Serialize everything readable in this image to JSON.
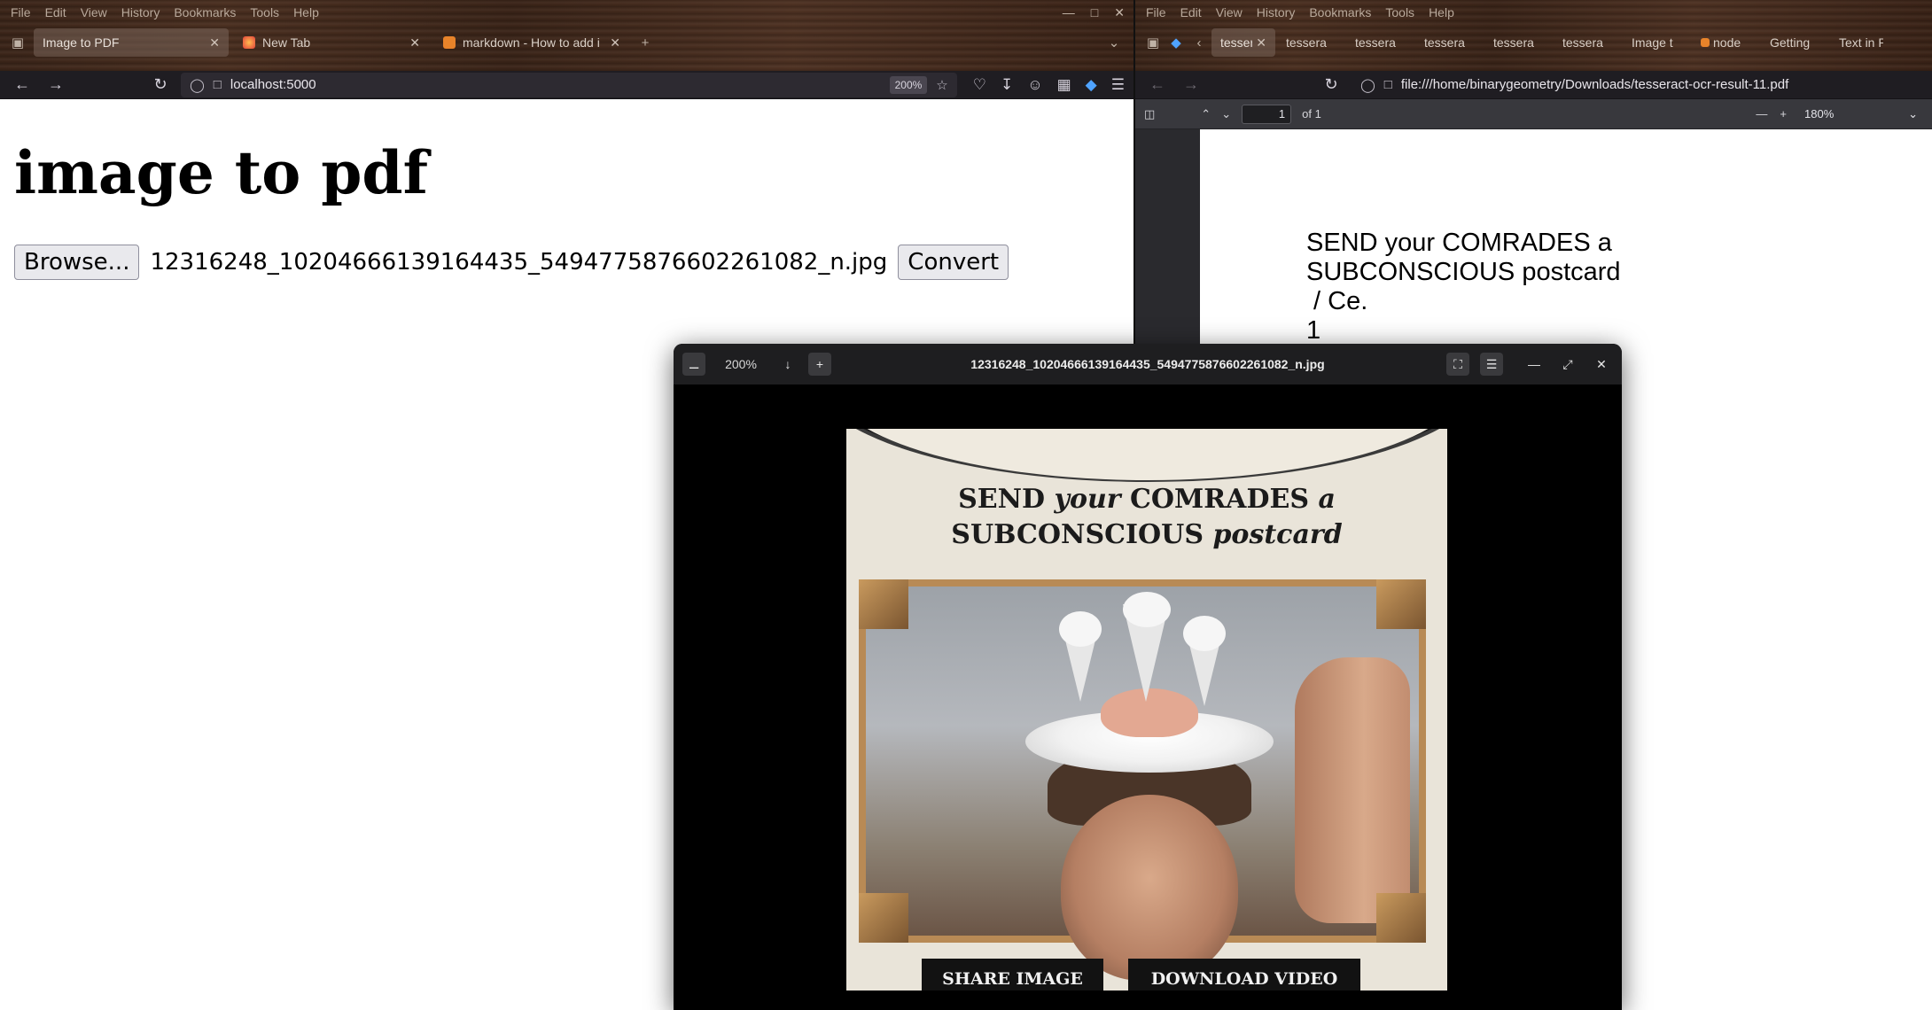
{
  "left_browser": {
    "menu": [
      "File",
      "Edit",
      "View",
      "History",
      "Bookmarks",
      "Tools",
      "Help"
    ],
    "tabs": [
      {
        "label": "Image to PDF",
        "active": true
      },
      {
        "label": "New Tab",
        "active": false
      },
      {
        "label": "markdown - How to add i",
        "active": false
      }
    ],
    "url": "localhost:5000",
    "zoom": "200%",
    "page": {
      "heading": "image to pdf",
      "browse_label": "Browse...",
      "file_name": "12316248_10204666139164435_5494775876602261082_n.jpg",
      "convert_label": "Convert"
    }
  },
  "right_browser": {
    "menu": [
      "File",
      "Edit",
      "View",
      "History",
      "Bookmarks",
      "Tools",
      "Help"
    ],
    "tabs": [
      "tesser",
      "tessera",
      "tessera",
      "tessera",
      "tessera",
      "tessera",
      "Image t",
      "node",
      "Getting",
      "Text in P"
    ],
    "url": "file:///home/binarygeometry/Downloads/tesseract-ocr-result-11.pdf",
    "pdf": {
      "page_number": "1",
      "page_count": "of 1",
      "zoom": "180%",
      "ocr_text": "SEND your COMRADES a\nSUBCONSCIOUS postcard\n / Ce.\n1"
    }
  },
  "image_viewer": {
    "zoom": "200%",
    "title": "12316248_10204666139164435_5494775876602261082_n.jpg",
    "postcard_line1_a": "SEND ",
    "postcard_line1_b": "your",
    "postcard_line1_c": " COMRADES ",
    "postcard_line1_d": "a",
    "postcard_line2_a": "SUBCONSCIOUS ",
    "postcard_line2_b": "postcard",
    "share_button": "SHARE IMAGE",
    "download_button": "DOWNLOAD VIDEO"
  },
  "colors": {
    "chrome_bg": "#1f1d22",
    "wood": "#3f281c",
    "viewer_header": "#1e1e20",
    "pdf_toolbar": "#38383d"
  }
}
